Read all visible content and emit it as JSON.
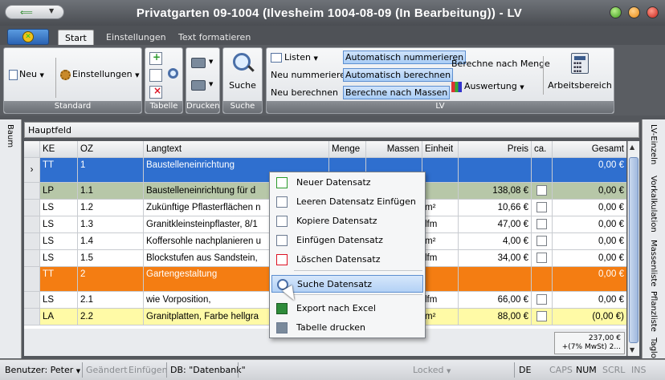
{
  "window": {
    "title": "Privatgarten 09-1004 (Ilvesheim 1004-08-09 (In Bearbeitung)) - LV"
  },
  "tabs": [
    "Start",
    "Einstellungen",
    "Text formatieren"
  ],
  "ribbon": {
    "standard": {
      "label": "Standard",
      "neu": "Neu",
      "einstellungen": "Einstellungen"
    },
    "tabelle": {
      "label": "Tabelle"
    },
    "drucken": {
      "label": "Drucken"
    },
    "suche": {
      "label": "Suche",
      "button": "Suche"
    },
    "lv": {
      "label": "LV",
      "listen": "Listen",
      "neu_nummerieren": "Neu nummerieren",
      "neu_berechnen": "Neu berechnen",
      "auto_nummerieren": "Automatisch nummerieren",
      "auto_berechnen": "Automatisch berechnen",
      "berechne_massen": "Berechne nach Massen",
      "berechne_menge": "Berechne nach Menge",
      "auswertung": "Auswertung",
      "arbeitsbereich": "Arbeitsbereich"
    }
  },
  "left_panel": {
    "label": "Baum"
  },
  "right_panel": {
    "tabs": [
      "LV-Einzeln",
      "Vorkalkulation",
      "Massenliste",
      "Pflanzliste",
      "Taglo"
    ]
  },
  "hauptfeld": "Hauptfeld",
  "grid": {
    "columns": [
      "KE",
      "OZ",
      "Langtext",
      "Menge",
      "Massen",
      "Einheit",
      "Preis",
      "ca.",
      "Gesamt"
    ],
    "rows": [
      {
        "ke": "TT",
        "oz": "1",
        "text": "Baustelleneinrichtung",
        "menge": "",
        "massen": "",
        "einheit": "",
        "preis": "",
        "check": false,
        "gesamt": "0,00 €",
        "style": "selected"
      },
      {
        "ke": "LP",
        "oz": "1.1",
        "text": "Baustelleneinrichtung für d",
        "menge": "",
        "massen": "",
        "einheit": "",
        "preis": "138,08 €",
        "check": true,
        "gesamt": "0,00 €",
        "style": "lp"
      },
      {
        "ke": "LS",
        "oz": "1.2",
        "text": "Zukünftige Pflasterflächen n",
        "menge": "",
        "massen": "",
        "einheit": "m²",
        "preis": "10,66 €",
        "check": true,
        "gesamt": "0,00 €",
        "style": "normal"
      },
      {
        "ke": "LS",
        "oz": "1.3",
        "text": "Granitkleinsteinpflaster, 8/1",
        "menge": "",
        "massen": "",
        "einheit": "lfm",
        "preis": "47,00 €",
        "check": true,
        "gesamt": "0,00 €",
        "style": "normal"
      },
      {
        "ke": "LS",
        "oz": "1.4",
        "text": "Koffersohle nachplanieren u",
        "menge": "",
        "massen": "",
        "einheit": "m²",
        "preis": "4,00 €",
        "check": true,
        "gesamt": "0,00 €",
        "style": "normal"
      },
      {
        "ke": "LS",
        "oz": "1.5",
        "text": "Blockstufen aus Sandstein,",
        "menge": "",
        "massen": "",
        "einheit": "lfm",
        "preis": "34,00 €",
        "check": true,
        "gesamt": "0,00 €",
        "style": "normal"
      },
      {
        "ke": "TT",
        "oz": "2",
        "text": "Gartengestaltung",
        "menge": "",
        "massen": "",
        "einheit": "",
        "preis": "",
        "check": false,
        "gesamt": "0,00 €",
        "style": "orange"
      },
      {
        "ke": "LS",
        "oz": "2.1",
        "text": "wie Vorposition,",
        "menge": "",
        "massen": "",
        "einheit": "lfm",
        "preis": "66,00 €",
        "check": true,
        "gesamt": "0,00 €",
        "style": "normal"
      },
      {
        "ke": "LA",
        "oz": "2.2",
        "text": "Granitplatten, Farbe hellgra",
        "menge": "",
        "massen": "",
        "einheit": "m²",
        "preis": "88,00 €",
        "check": true,
        "gesamt": "(0,00 €)",
        "style": "yellow"
      }
    ],
    "footer_total": "237,00 €",
    "footer_mwst": "+(7% MwSt) 2..."
  },
  "context_menu": {
    "items": [
      "Neuer Datensatz",
      "Leeren Datensatz Einfügen",
      "Kopiere Datensatz",
      "Einfügen Datensatz",
      "Löschen Datensatz",
      "Suche Datensatz",
      "Export nach Excel",
      "Tabelle drucken"
    ]
  },
  "statusbar": {
    "benutzer": "Benutzer: Peter",
    "geaendert": "Geändert",
    "einfuegen": "Einfügen",
    "db": "DB: \"Datenbank\"",
    "locked": "Locked",
    "lang": "DE",
    "caps": "CAPS",
    "num": "NUM",
    "scrl": "SCRL",
    "ins": "INS"
  },
  "colors": {
    "selected_row": "#2f6fcf",
    "orange_row": "#f47d12",
    "lp_row": "#b7c7a8",
    "yellow_row": "#fffaa6",
    "menu_hover": "#b3d1f5"
  }
}
